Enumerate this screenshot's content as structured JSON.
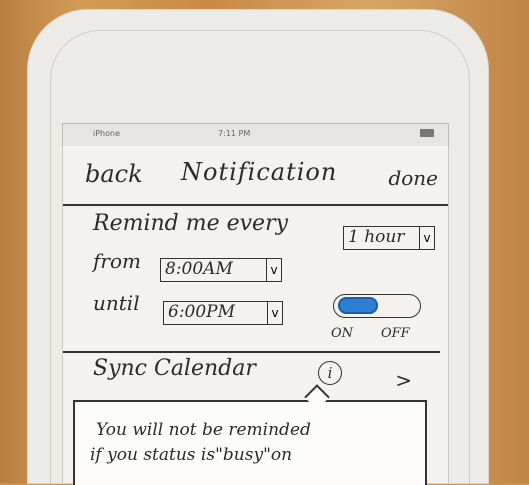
{
  "status_bar": {
    "carrier": "iPhone",
    "time": "7:11 PM"
  },
  "nav": {
    "back_label": "back",
    "title": "Notification",
    "done_label": "done"
  },
  "remind": {
    "label": "Remind me every",
    "interval_value": "1 hour",
    "from_label": "from",
    "from_value": "8:00AM",
    "until_label": "until",
    "until_value": "6:00PM",
    "toggle_on_label": "ON",
    "toggle_off_label": "OFF",
    "toggle_state": "on"
  },
  "sync": {
    "label": "Sync Calendar",
    "info_glyph": "i",
    "chevron": ">"
  },
  "tooltip": {
    "line1": "You will not be reminded",
    "line2": "if you status is\"busy\"on"
  },
  "colors": {
    "toggle_on": "#2e7fd4",
    "ink": "#2b2b2b",
    "paper": "#f3f2ee"
  }
}
